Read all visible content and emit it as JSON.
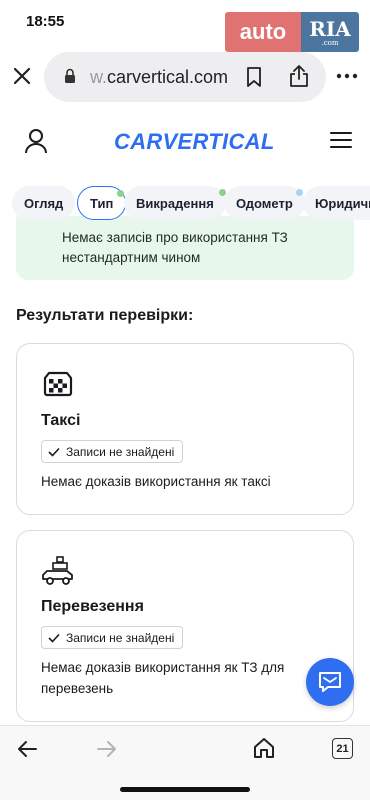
{
  "status_bar": {
    "time": "18:55"
  },
  "watermark": {
    "auto": "auto",
    "ria": "RIA",
    "ria_sub": ".com"
  },
  "browser": {
    "url_dim": "w.",
    "url_main": "carvertical.com"
  },
  "site": {
    "logo": "CARVERTICAL"
  },
  "tabs": [
    {
      "label": "Огляд"
    },
    {
      "label": "Тип",
      "dot_color": "#8ed08e"
    },
    {
      "label": "Викрадення",
      "dot_color": "#8ed08e"
    },
    {
      "label": "Одометр",
      "dot_color": "#a9d3f5"
    },
    {
      "label": "Юридичн"
    }
  ],
  "notice": {
    "text": "Немає записів про використання ТЗ нестандартним чином"
  },
  "results": {
    "title": "Результати перевірки:",
    "cards": [
      {
        "icon": "taxi-icon",
        "title": "Таксі",
        "badge": "Записи не знайдені",
        "description": "Немає доказів використання як таксі"
      },
      {
        "icon": "cargo-car-icon",
        "title": "Перевезення",
        "badge": "Записи не знайдені",
        "description": "Немає доказів використання як ТЗ для перевезень"
      }
    ]
  },
  "bottom_nav": {
    "tab_count": "21"
  },
  "colors": {
    "accent": "#2f6ef0",
    "notice_bg": "#e8f7ec"
  }
}
